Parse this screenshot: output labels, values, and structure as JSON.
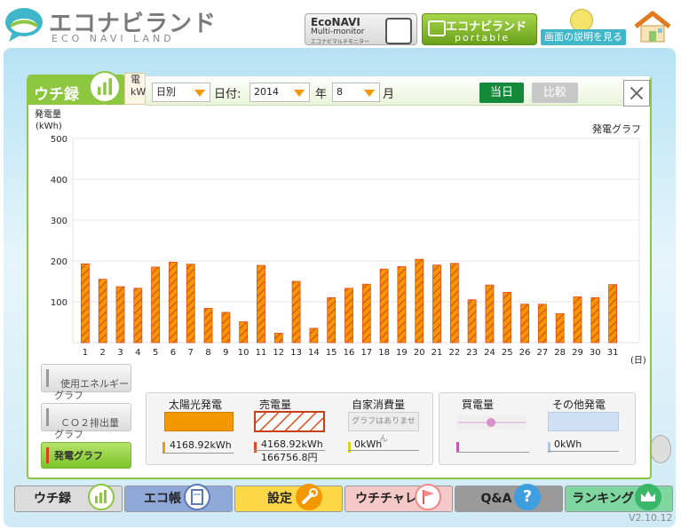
{
  "header": {
    "logo_title": "エコナビランド",
    "logo_subtitle": "ECO NAVI LAND",
    "multimonitor": {
      "line1": "EcoNAVI",
      "line2": "Multi-monitor",
      "line3": "エコナビマルチモニター"
    },
    "portable": {
      "line1": "エコナビランド",
      "line2": "portable"
    },
    "help_label": "画面の説明を見る"
  },
  "panel": {
    "title": "ウチ録",
    "tab_peek": "電\nkW",
    "period_select": "日別",
    "date_label": "日付:",
    "year_value": "2014",
    "year_unit": "年",
    "month_value": "8",
    "month_unit": "月",
    "today_label": "当日",
    "compare_label": "比較",
    "close_label": "×"
  },
  "chart_data": {
    "type": "bar",
    "title": "発電グラフ",
    "ylabel": "発電量\n(kWh)",
    "xlabel": "(日)",
    "ylim": [
      0,
      500
    ],
    "yticks": [
      100,
      200,
      300,
      400,
      500
    ],
    "categories": [
      "1",
      "2",
      "3",
      "4",
      "5",
      "6",
      "7",
      "8",
      "9",
      "10",
      "11",
      "12",
      "13",
      "14",
      "15",
      "16",
      "17",
      "18",
      "19",
      "20",
      "21",
      "22",
      "23",
      "24",
      "25",
      "26",
      "27",
      "28",
      "29",
      "30",
      "31"
    ],
    "values": [
      193,
      155,
      137,
      133,
      185,
      197,
      192,
      84,
      74,
      51,
      189,
      23,
      150,
      35,
      110,
      133,
      143,
      180,
      186,
      204,
      190,
      194,
      105,
      141,
      123,
      94,
      94,
      71,
      112,
      110,
      142
    ],
    "bar_color": "#f39800",
    "hatch_color": "#e04a1c",
    "grid": true
  },
  "side_buttons": [
    {
      "label": "使用エネルギー\nグラフ"
    },
    {
      "label": "ＣＯ２排出量\nグラフ"
    },
    {
      "label": "発電グラフ"
    }
  ],
  "legend": {
    "solar": {
      "label": "太陽光発電",
      "value": "4168.92kWh",
      "color": "#f39800"
    },
    "sold": {
      "label": "売電量",
      "value": "4168.92kWh",
      "value2": "166756.8円",
      "color": "#e04a1c"
    },
    "self": {
      "label": "自家消費量",
      "note": "グラフはありません",
      "value": "0kWh",
      "color": "#d6d61e"
    },
    "bought": {
      "label": "買電量",
      "value": "",
      "color": "#c45bb0"
    },
    "other": {
      "label": "その他発電",
      "value": "0kWh",
      "color": "#a8c8e8"
    }
  },
  "nav": [
    {
      "label": "ウチ録",
      "color": "#dcdcdc"
    },
    {
      "label": "エコ帳",
      "color": "#8fa8d8"
    },
    {
      "label": "設定",
      "color": "#ffd84a"
    },
    {
      "label": "ウチチャレ",
      "color": "#f6c9c9"
    },
    {
      "label": "Q&A",
      "color": "#9a9a9a"
    },
    {
      "label": "ランキング",
      "color": "#7fd6a0"
    }
  ],
  "version": "V2.10.12"
}
